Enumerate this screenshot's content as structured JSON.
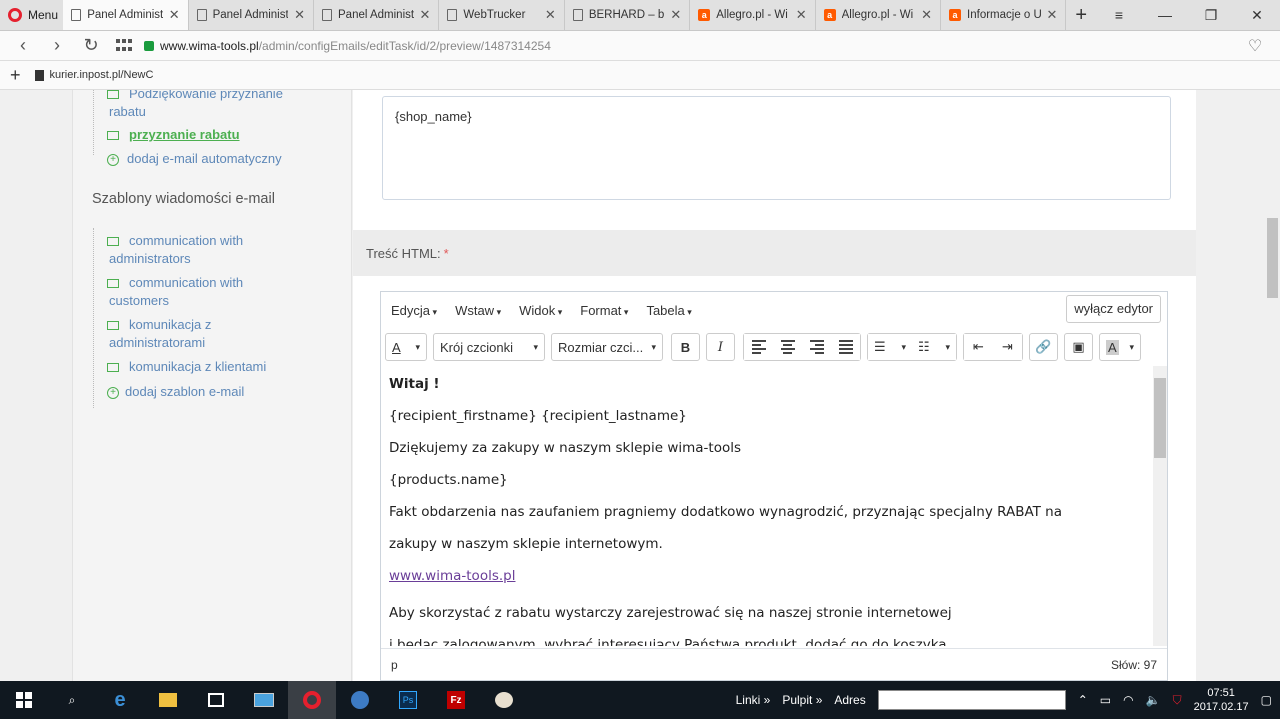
{
  "browser": {
    "menu_label": "Menu",
    "tabs": [
      {
        "title": "Panel Administ",
        "icon": "document-icon",
        "active": true
      },
      {
        "title": "Panel Administ",
        "icon": "document-icon",
        "active": false
      },
      {
        "title": "Panel Administ",
        "icon": "document-icon",
        "active": false
      },
      {
        "title": "WebTrucker",
        "icon": "document-icon",
        "active": false
      },
      {
        "title": "BERHARD – ber",
        "icon": "document-icon",
        "active": false
      },
      {
        "title": "Allegro.pl - Wi",
        "icon": "allegro-icon",
        "active": false
      },
      {
        "title": "Allegro.pl - Wi",
        "icon": "allegro-icon",
        "active": false
      },
      {
        "title": "Informacje o U",
        "icon": "allegro-icon",
        "active": false
      }
    ],
    "url_host": "www.wima-tools.pl",
    "url_path": "/admin/configEmails/editTask/id/2/preview/1487314254",
    "bookmark": "kurier.inpost.pl/NewC"
  },
  "sidebar": {
    "auto_items": [
      {
        "label_line1": "Podziękowanie przyznanie",
        "label_line2": "rabatu"
      },
      {
        "label": "przyznanie rabatu",
        "active": true
      },
      {
        "label": "dodaj e-mail automatyczny"
      }
    ],
    "templates_heading": "Szablony wiadomości e-mail",
    "template_items": [
      {
        "line1": "communication with",
        "line2": "administrators"
      },
      {
        "line1": "communication with",
        "line2": "customers"
      },
      {
        "line1": "komunikacja z",
        "line2": "administratorami"
      },
      {
        "line1": "komunikacja z klientami",
        "line2": ""
      }
    ],
    "add_template": "dodaj szablon e-mail"
  },
  "form": {
    "subject_value": "{shop_name}",
    "html_label": "Treść HTML:",
    "required_mark": "*"
  },
  "editor": {
    "menu": [
      "Edycja",
      "Wstaw",
      "Widok",
      "Format",
      "Tabela"
    ],
    "disable_button": "wyłącz edytor",
    "font_family": "Krój czcionki",
    "font_size": "Rozmiar czci...",
    "content": {
      "greeting": "Witaj !",
      "recipient": "{recipient_firstname} {recipient_lastname}",
      "thanks": "Dziękujemy za zakupy w naszym sklepie wima-tools",
      "products": "{products.name}",
      "fact": "Fakt obdarzenia nas zaufaniem pragniemy dodatkowo wynagrodzić, przyznając specjalny RABAT na",
      "fact2": "zakupy w naszym sklepie internetowym.",
      "link": "www.wima-tools.pl",
      "howto": "Aby skorzystać z rabatu wystarczy zarejestrować się na naszej stronie internetowej",
      "howto2": "i będąc zalogowanym, wybrać interesujący Państwa produkt, dodać go do koszyka"
    },
    "status_path": "p",
    "word_count": "Słów: 97"
  },
  "taskbar": {
    "links": "Linki",
    "desktop": "Pulpit",
    "address": "Adres",
    "time": "07:51",
    "date": "2017.02.17"
  }
}
